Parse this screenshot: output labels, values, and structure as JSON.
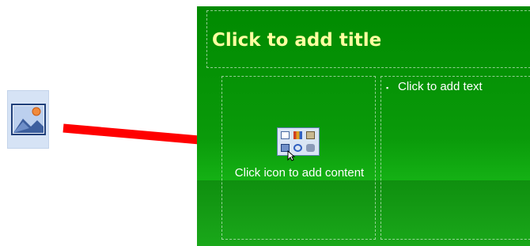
{
  "slide": {
    "title_placeholder": "Click to add title",
    "content_placeholder": "Click icon to add content",
    "text_placeholder": "Click to add text",
    "bullet": "▪"
  },
  "icons": {
    "insert_picture": "insert-picture-icon",
    "content_palette": "content-palette-icon",
    "pointer": "mouse-pointer-icon"
  },
  "colors": {
    "slide_background": "#008a00",
    "title_text": "#ffffa0",
    "arrow": "#ff0000"
  }
}
